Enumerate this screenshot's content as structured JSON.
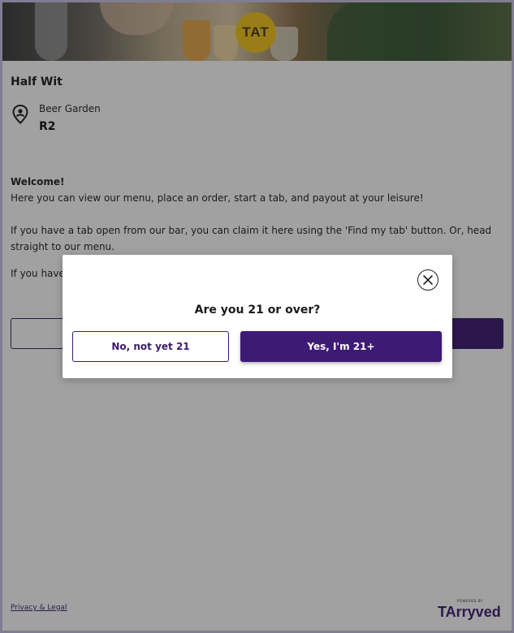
{
  "hero": {
    "logo_text": "TAT"
  },
  "venue": {
    "name": "Half Wit",
    "area": "Beer Garden",
    "table": "R2"
  },
  "welcome": {
    "title": "Welcome!",
    "line1": "Here you can view our menu, place an order, start a tab, and payout at your leisure!",
    "para2": "If you have a tab open from our bar, you can claim it here using the 'Find my tab' button. Or, head straight to our menu.",
    "para3": "If you have"
  },
  "modal": {
    "question": "Are you 21 or over?",
    "no_label": "No, not yet 21",
    "yes_label": "Yes, I'm 21+"
  },
  "footer": {
    "privacy_link": "Privacy & Legal",
    "powered_by": "POWERED BY",
    "brand": "TArryved"
  },
  "colors": {
    "accent": "#3d1a73",
    "logo_yellow": "#f2c51b",
    "frame": "#c9c4e6"
  },
  "icons": {
    "location": "location-pin-icon",
    "close": "close-icon"
  }
}
